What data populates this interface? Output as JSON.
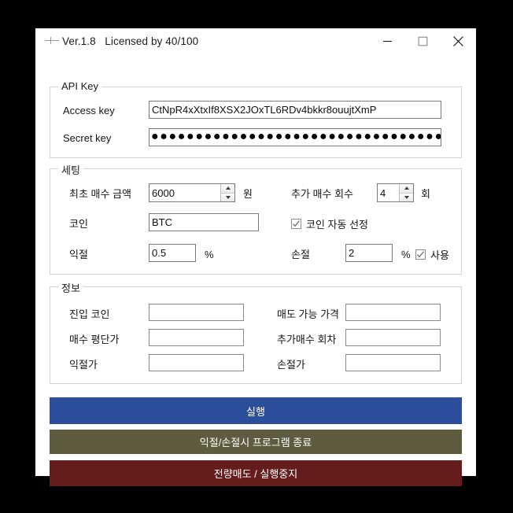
{
  "window": {
    "title": "Ver.1.8   Licensed by 40/100",
    "icon": "app-dash-icon",
    "controls": {
      "minimize": "minimize-icon",
      "maximize": "maximize-icon",
      "close": "close-icon"
    }
  },
  "api_group": {
    "title": "API Key",
    "access_label": "Access key",
    "access_value": "CtNpR4xXtxIf8XSX2JOxTL6RDv4bkkr8ouujtXmP",
    "secret_label": "Secret key",
    "secret_value": "●●●●●●●●●●●●●●●●●●●●●●●●●●●●●●●●●●●●●●●●"
  },
  "settings_group": {
    "title": "세팅",
    "first_buy_label": "최초 매수 금액",
    "first_buy_value": "6000",
    "first_buy_unit": "원",
    "extra_buy_label": "추가 매수 회수",
    "extra_buy_value": "4",
    "extra_buy_unit": "회",
    "coin_label": "코인",
    "coin_value": "BTC",
    "auto_coin_label": "코인 자동 선정",
    "auto_coin_checked": true,
    "take_profit_label": "익절",
    "take_profit_value": "0.5",
    "take_profit_unit": "%",
    "stop_loss_label": "손절",
    "stop_loss_value": "2",
    "stop_loss_unit": "%",
    "stop_loss_use_label": "사용",
    "stop_loss_use_checked": true
  },
  "info_group": {
    "title": "정보",
    "entry_coin_label": "진입 코인",
    "entry_coin_value": "",
    "sellable_price_label": "매도 가능 가격",
    "sellable_price_value": "",
    "avg_buy_label": "매수 평단가",
    "avg_buy_value": "",
    "extra_buy_round_label": "추가매수 회차",
    "extra_buy_round_value": "",
    "take_profit_price_label": "익절가",
    "take_profit_price_value": "",
    "stop_loss_price_label": "손절가",
    "stop_loss_price_value": ""
  },
  "actions": {
    "run_label": "실행",
    "exit_on_close_label": "익절/손절시 프로그램 종료",
    "sell_all_label": "전량매도 / 실행중지"
  },
  "colors": {
    "run": "#2c4f9c",
    "exit": "#5f5b40",
    "sell": "#651c1c",
    "window_bg": "#ffffff",
    "page_bg": "#000000"
  }
}
